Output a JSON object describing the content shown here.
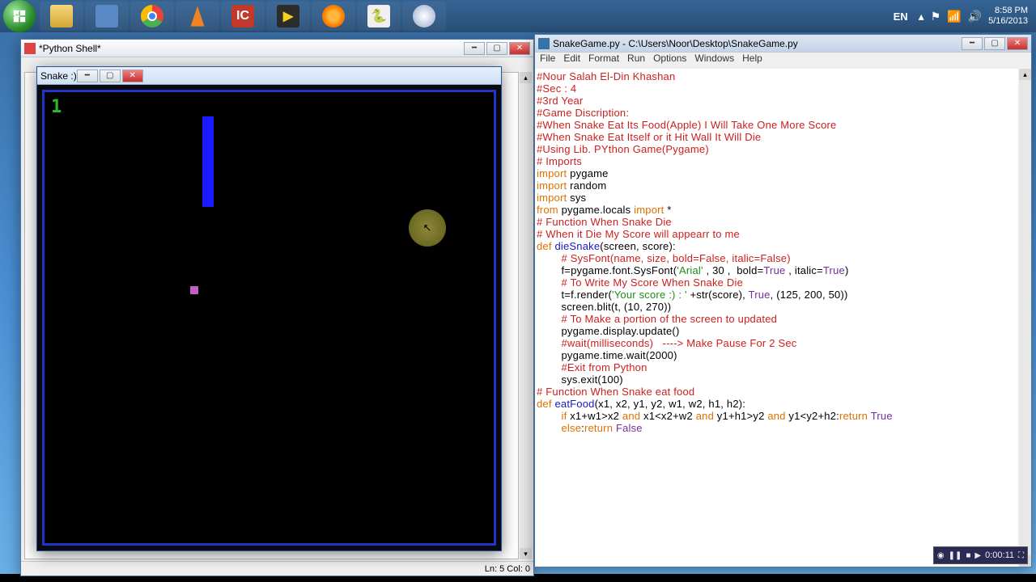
{
  "taskbar": {
    "items": [
      "folder",
      "notepad",
      "chrome",
      "vlc",
      "idm",
      "media",
      "firefox",
      "pyscript",
      "disc"
    ],
    "lang": "EN",
    "time": "8:58 PM",
    "date": "5/16/2013"
  },
  "shell": {
    "title": "*Python Shell*",
    "status": "Ln: 5 Col: 0"
  },
  "game": {
    "title": "Snake :)",
    "score": "1"
  },
  "editor": {
    "title": "SnakeGame.py - C:\\Users\\Noor\\Desktop\\SnakeGame.py",
    "menus": [
      "File",
      "Edit",
      "Format",
      "Run",
      "Options",
      "Windows",
      "Help"
    ],
    "lines": [
      {
        "t": "#Nour Salah El-Din Khashan",
        "cls": "c-comment"
      },
      {
        "t": "#Sec : 4",
        "cls": "c-comment"
      },
      {
        "t": "#3rd Year",
        "cls": "c-comment"
      },
      {
        "t": "",
        "cls": ""
      },
      {
        "t": "",
        "cls": ""
      },
      {
        "t": "#Game Discription:",
        "cls": "c-comment"
      },
      {
        "t": "#When Snake Eat Its Food(Apple) I Will Take One More Score",
        "cls": "c-comment"
      },
      {
        "t": "#When Snake Eat Itself or it Hit Wall It Will Die",
        "cls": "c-comment"
      },
      {
        "t": "#Using Lib. PYthon Game(Pygame)",
        "cls": "c-comment"
      },
      {
        "t": "",
        "cls": ""
      },
      {
        "t": "",
        "cls": ""
      },
      {
        "t": "",
        "cls": ""
      },
      {
        "t": "# Imports",
        "cls": "c-comment"
      },
      {
        "html": "<span class='c-kw'>import</span> pygame"
      },
      {
        "html": "<span class='c-kw'>import</span> random"
      },
      {
        "html": "<span class='c-kw'>import</span> sys"
      },
      {
        "html": "<span class='c-kw'>from</span> pygame.locals <span class='c-kw'>import</span> *"
      },
      {
        "t": "# Function When Snake Die",
        "cls": "c-comment"
      },
      {
        "t": "# When it Die My Score will appearr to me",
        "cls": "c-comment"
      },
      {
        "html": "<span class='c-kw'>def</span> <span class='c-def'>dieSnake</span>(screen, score):"
      },
      {
        "html": "        <span class='c-comment'># SysFont(name, size, bold=False, italic=False)</span>"
      },
      {
        "html": "        f=pygame.font.SysFont(<span class='c-str'>'Arial'</span> , 30 ,  bold=<span class='c-bi'>True</span> , italic=<span class='c-bi'>True</span>)"
      },
      {
        "html": "        <span class='c-comment'># To Write My Score When Snake Die</span>"
      },
      {
        "html": "        t=f.render(<span class='c-str'>'Your score :) : '</span> +str(score), <span class='c-bi'>True</span>, (125, 200, 50))"
      },
      {
        "html": "        screen.blit(t, (10, 270))"
      },
      {
        "html": "        <span class='c-comment'># To Make a portion of the screen to updated</span>"
      },
      {
        "html": "        pygame.display.update()"
      },
      {
        "html": "        <span class='c-comment'>#wait(milliseconds)   ----> Make Pause For 2 Sec</span>"
      },
      {
        "html": "        pygame.time.wait(2000)"
      },
      {
        "html": "        <span class='c-comment'>#Exit from Python</span>"
      },
      {
        "html": "        sys.exit(100)"
      },
      {
        "t": "",
        "cls": ""
      },
      {
        "t": "# Function When Snake eat food",
        "cls": "c-comment"
      },
      {
        "html": "<span class='c-kw'>def</span> <span class='c-def'>eatFood</span>(x1, x2, y1, y2, w1, w2, h1, h2):"
      },
      {
        "t": "",
        "cls": ""
      },
      {
        "html": "        <span class='c-kw'>if</span> x1+w1&gt;x2 <span class='c-kw'>and</span> x1&lt;x2+w2 <span class='c-kw'>and</span> y1+h1&gt;y2 <span class='c-kw'>and</span> y1&lt;y2+h2:<span class='c-kw'>return</span> <span class='c-bi'>True</span>"
      },
      {
        "html": "        <span class='c-kw'>else</span>:<span class='c-kw'>return</span> <span class='c-bi'>False</span>"
      }
    ]
  },
  "recorder": {
    "time": "0:00:11"
  }
}
